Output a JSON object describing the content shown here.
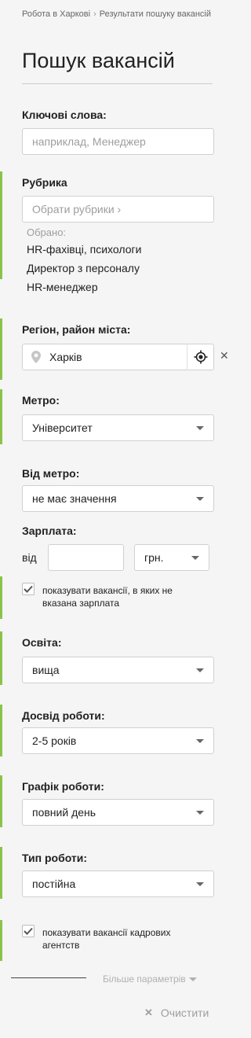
{
  "breadcrumb": {
    "home": "Робота в Харкові",
    "current": "Результати пошуку вакансій"
  },
  "title": "Пошук вакансій",
  "keywords": {
    "label": "Ключові слова:",
    "placeholder": "наприклад, Менеджер"
  },
  "rubric": {
    "label": "Рубрика",
    "placeholder": "Обрати рубрики ›",
    "chosen_label": "Обрано:",
    "items": [
      "HR-фахівці, психологи",
      "Директор з персоналу",
      "HR-менеджер"
    ]
  },
  "region": {
    "label": "Регіон, район міста:",
    "value": "Харків"
  },
  "metro": {
    "label": "Метро:",
    "value": "Університет"
  },
  "distance": {
    "label": "Від метро:",
    "value": "не має значення"
  },
  "salary": {
    "label": "Зарплата:",
    "from": "від",
    "currency": "грн.",
    "value": ""
  },
  "salary_checkbox": {
    "checked": true,
    "text": "показувати вакансії, в яких не вказана зарплата"
  },
  "education": {
    "label": "Освіта:",
    "value": "вища"
  },
  "experience": {
    "label": "Досвід роботи:",
    "value": "2-5 років"
  },
  "schedule": {
    "label": "Графік роботи:",
    "value": "повний день"
  },
  "job_type": {
    "label": "Тип роботи:",
    "value": "постійна"
  },
  "agency_checkbox": {
    "checked": true,
    "text": "показувати вакансії кадрових агентств"
  },
  "more_params": "Більше параметрів",
  "clear": "Очистити",
  "colors": {
    "accent": "#8bc34a"
  }
}
